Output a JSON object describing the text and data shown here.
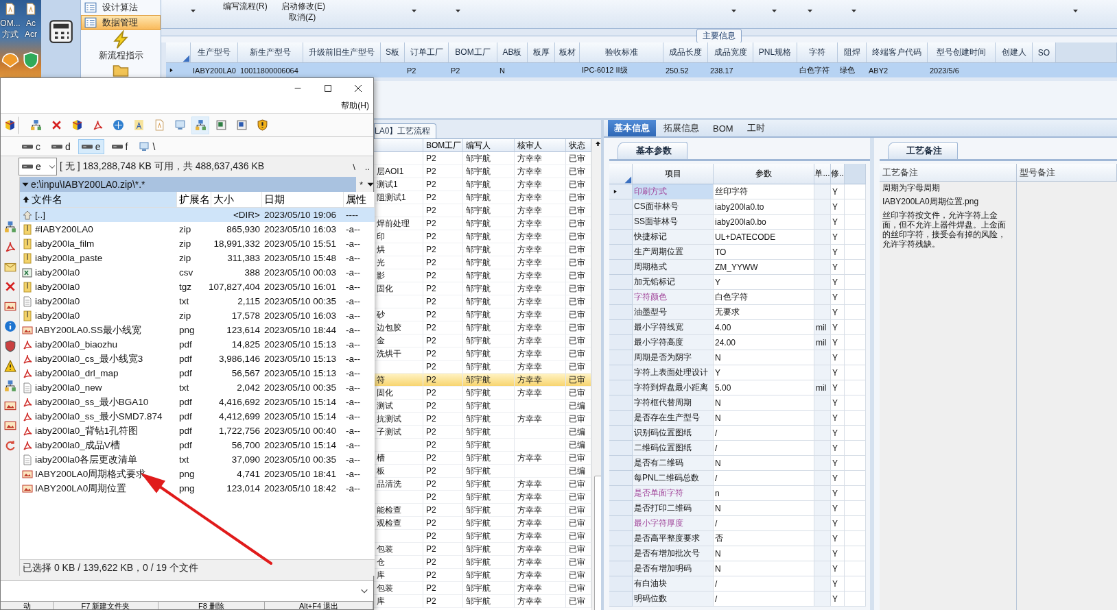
{
  "desktop": {
    "labels": [
      "OM...",
      "方式",
      "Ac",
      "Acr"
    ]
  },
  "nav": {
    "items": [
      {
        "label": "设计算法",
        "kind": "row",
        "selected": false
      },
      {
        "label": "数据管理",
        "kind": "row",
        "selected": true
      },
      {
        "label": "新流程指示",
        "kind": "large",
        "selected": false
      }
    ]
  },
  "ribbon": {
    "commands": [
      "编写流程(R)",
      "启动修改(E)",
      "取消(Z)"
    ]
  },
  "main_info": {
    "title": "主要信息",
    "columns": [
      "生产型号",
      "新生产型号",
      "升级前旧生产型号",
      "S板",
      "订单工厂",
      "BOM工厂",
      "AB板",
      "板厚",
      "板材",
      "验收标准",
      "成品长度",
      "成品宽度",
      "PNL规格",
      "字符",
      "阻焊",
      "终端客户代码",
      "型号创建时间",
      "创建人",
      "SO"
    ],
    "rows": [
      {
        "selected": true,
        "cells": [
          "IABY200LA0",
          "10011800006064",
          null,
          null,
          "P2",
          "P2",
          "N",
          null,
          null,
          "IPC-6012 II级",
          "250.52",
          "238.17",
          null,
          "白色字符",
          "绿色",
          "ABY2",
          "2023/5/6",
          null,
          null
        ]
      }
    ]
  },
  "process_flow": {
    "tab": "LA0】工艺流程",
    "columns": [
      "BOM工厂",
      "编写人",
      "核审人",
      "状态"
    ],
    "rows": [
      {
        "factory": "P2",
        "writer": "邹宇航",
        "reviewer": "方幸幸",
        "status": "已审",
        "selected": false
      },
      {
        "step": "层AOI1",
        "factory": "P2",
        "writer": "邹宇航",
        "reviewer": "方幸幸",
        "status": "已审",
        "selected": false
      },
      {
        "step": "测试1",
        "factory": "P2",
        "writer": "邹宇航",
        "reviewer": "方幸幸",
        "status": "已审",
        "selected": false
      },
      {
        "step": "阻测试1",
        "factory": "P2",
        "writer": "邹宇航",
        "reviewer": "方幸幸",
        "status": "已审",
        "selected": false
      },
      {
        "factory": "P2",
        "writer": "邹宇航",
        "reviewer": "方幸幸",
        "status": "已审",
        "selected": false
      },
      {
        "step": "焊前处理",
        "factory": "P2",
        "writer": "邹宇航",
        "reviewer": "方幸幸",
        "status": "已审",
        "selected": false
      },
      {
        "step": "印",
        "factory": "P2",
        "writer": "邹宇航",
        "reviewer": "方幸幸",
        "status": "已审",
        "selected": false
      },
      {
        "step": "烘",
        "factory": "P2",
        "writer": "邹宇航",
        "reviewer": "方幸幸",
        "status": "已审",
        "selected": false
      },
      {
        "step": "光",
        "factory": "P2",
        "writer": "邹宇航",
        "reviewer": "方幸幸",
        "status": "已审",
        "selected": false
      },
      {
        "step": "影",
        "factory": "P2",
        "writer": "邹宇航",
        "reviewer": "方幸幸",
        "status": "已审",
        "selected": false
      },
      {
        "step": "固化",
        "factory": "P2",
        "writer": "邹宇航",
        "reviewer": "方幸幸",
        "status": "已审",
        "selected": false
      },
      {
        "factory": "P2",
        "writer": "邹宇航",
        "reviewer": "方幸幸",
        "status": "已审",
        "selected": false
      },
      {
        "step": "砂",
        "factory": "P2",
        "writer": "邹宇航",
        "reviewer": "方幸幸",
        "status": "已审",
        "selected": false
      },
      {
        "step": "边包胶",
        "factory": "P2",
        "writer": "邹宇航",
        "reviewer": "方幸幸",
        "status": "已审",
        "selected": false
      },
      {
        "step": "金",
        "factory": "P2",
        "writer": "邹宇航",
        "reviewer": "方幸幸",
        "status": "已审",
        "selected": false
      },
      {
        "step": "洗烘干",
        "factory": "P2",
        "writer": "邹宇航",
        "reviewer": "方幸幸",
        "status": "已审",
        "selected": false
      },
      {
        "factory": "P2",
        "writer": "邹宇航",
        "reviewer": "方幸幸",
        "status": "已审",
        "selected": false
      },
      {
        "step": "符",
        "factory": "P2",
        "writer": "邹宇航",
        "reviewer": "方幸幸",
        "status": "已审",
        "selected": true
      },
      {
        "step": "固化",
        "factory": "P2",
        "writer": "邹宇航",
        "reviewer": "方幸幸",
        "status": "已审",
        "selected": false
      },
      {
        "step": "测试",
        "factory": "P2",
        "writer": "邹宇航",
        "status": "已编",
        "selected": false
      },
      {
        "step": "抗测试",
        "factory": "P2",
        "writer": "邹宇航",
        "reviewer": "方幸幸",
        "status": "已审",
        "selected": false
      },
      {
        "step": "子测试",
        "factory": "P2",
        "writer": "邹宇航",
        "status": "已编",
        "selected": false
      },
      {
        "factory": "P2",
        "writer": "邹宇航",
        "status": "已编",
        "selected": false
      },
      {
        "step": "槽",
        "factory": "P2",
        "writer": "邹宇航",
        "reviewer": "方幸幸",
        "status": "已审",
        "selected": false
      },
      {
        "step": "板",
        "factory": "P2",
        "writer": "邹宇航",
        "status": "已编",
        "selected": false
      },
      {
        "step": "品清洗",
        "factory": "P2",
        "writer": "邹宇航",
        "reviewer": "方幸幸",
        "status": "已审",
        "selected": false
      },
      {
        "factory": "P2",
        "writer": "邹宇航",
        "reviewer": "方幸幸",
        "status": "已审",
        "selected": false
      },
      {
        "step": "能检查",
        "factory": "P2",
        "writer": "邹宇航",
        "reviewer": "方幸幸",
        "status": "已审",
        "selected": false
      },
      {
        "step": "观检查",
        "factory": "P2",
        "writer": "邹宇航",
        "reviewer": "方幸幸",
        "status": "已审",
        "selected": false
      },
      {
        "factory": "P2",
        "writer": "邹宇航",
        "reviewer": "方幸幸",
        "status": "已审",
        "selected": false
      },
      {
        "step": "包装",
        "factory": "P2",
        "writer": "邹宇航",
        "reviewer": "方幸幸",
        "status": "已审",
        "selected": false
      },
      {
        "step": "仓",
        "factory": "P2",
        "writer": "邹宇航",
        "reviewer": "方幸幸",
        "status": "已审",
        "selected": false
      },
      {
        "step": "库",
        "factory": "P2",
        "writer": "邹宇航",
        "reviewer": "方幸幸",
        "status": "已审",
        "selected": false
      },
      {
        "step": "包装",
        "factory": "P2",
        "writer": "邹宇航",
        "reviewer": "方幸幸",
        "status": "已审",
        "selected": false
      },
      {
        "step": "库",
        "factory": "P2",
        "writer": "邹宇航",
        "reviewer": "方幸幸",
        "status": "已审",
        "selected": false
      }
    ]
  },
  "right_panel": {
    "tabs": [
      {
        "label": "基本信息",
        "selected": true
      },
      {
        "label": "拓展信息",
        "selected": false
      },
      {
        "label": "BOM",
        "selected": false
      },
      {
        "label": "工时",
        "selected": false
      }
    ],
    "params": {
      "tab": "基本参数",
      "columns": [
        "项目",
        "参数",
        "单...",
        "修.."
      ],
      "rows": [
        {
          "item": "印刷方式",
          "value": "丝印字符",
          "flag": "Y",
          "flagged": true,
          "selected": true
        },
        {
          "item": "CS面菲林号",
          "value": "iaby200la0.to",
          "flag": "Y",
          "flagged": false,
          "selected": false
        },
        {
          "item": "SS面菲林号",
          "value": "iaby200la0.bo",
          "flag": "Y",
          "flagged": false,
          "selected": false
        },
        {
          "item": "快捷标记",
          "value": "UL+DATECODE",
          "flag": "Y",
          "flagged": false,
          "selected": false
        },
        {
          "item": "生产周期位置",
          "value": "TO",
          "flag": "Y",
          "flagged": false,
          "selected": false
        },
        {
          "item": "周期格式",
          "value": "ZM_YYWW",
          "flag": "Y",
          "flagged": false,
          "selected": false
        },
        {
          "item": "加无铅标记",
          "value": "Y",
          "flag": "Y",
          "flagged": false,
          "selected": false
        },
        {
          "item": "字符颜色",
          "value": "白色字符",
          "flag": "Y",
          "flagged": true,
          "selected": false
        },
        {
          "item": "油墨型号",
          "value": "无要求",
          "flag": "Y",
          "flagged": false,
          "selected": false
        },
        {
          "item": "最小字符线宽",
          "value": "4.00",
          "unit": "mil",
          "flag": "Y",
          "flagged": false,
          "selected": false
        },
        {
          "item": "最小字符高度",
          "value": "24.00",
          "unit": "mil",
          "flag": "Y",
          "flagged": false,
          "selected": false
        },
        {
          "item": "周期是否为阴字",
          "value": "N",
          "flag": "Y",
          "flagged": false,
          "selected": false
        },
        {
          "item": "字符上表面处理设计",
          "value": "Y",
          "flag": "Y",
          "flagged": false,
          "selected": false
        },
        {
          "item": "字符到焊盘最小距离",
          "value": "5.00",
          "unit": "mil",
          "flag": "Y",
          "flagged": false,
          "selected": false
        },
        {
          "item": "字符框代替周期",
          "value": "N",
          "flag": "Y",
          "flagged": false,
          "selected": false
        },
        {
          "item": "是否存在生产型号",
          "value": "N",
          "flag": "Y",
          "flagged": false,
          "selected": false
        },
        {
          "item": "识别码位置图纸",
          "value": "/",
          "flag": "Y",
          "flagged": false,
          "selected": false
        },
        {
          "item": "二维码位置图纸",
          "value": "/",
          "flag": "Y",
          "flagged": false,
          "selected": false
        },
        {
          "item": "是否有二维码",
          "value": "N",
          "flag": "Y",
          "flagged": false,
          "selected": false
        },
        {
          "item": "每PNL二维码总数",
          "value": "/",
          "flag": "Y",
          "flagged": false,
          "selected": false
        },
        {
          "item": "是否单面字符",
          "value": "n",
          "flag": "Y",
          "flagged": true,
          "selected": false
        },
        {
          "item": "是否打印二维码",
          "value": "N",
          "flag": "Y",
          "flagged": false,
          "selected": false
        },
        {
          "item": "最小字符厚度",
          "value": "/",
          "flag": "Y",
          "flagged": true,
          "selected": false
        },
        {
          "item": "是否高平整度要求",
          "value": "否",
          "flag": "Y",
          "flagged": false,
          "selected": false
        },
        {
          "item": "是否有增加批次号",
          "value": "N",
          "flag": "Y",
          "flagged": false,
          "selected": false
        },
        {
          "item": "是否有增加明码",
          "value": "N",
          "flag": "Y",
          "flagged": false,
          "selected": false
        },
        {
          "item": "有白油块",
          "value": "/",
          "flag": "Y",
          "flagged": false,
          "selected": false
        },
        {
          "item": "明码位数",
          "value": "/",
          "flag": "Y",
          "flagged": false,
          "selected": false
        }
      ]
    },
    "notes": {
      "tab": "工艺备注",
      "columns": [
        "工艺备注",
        "型号备注"
      ],
      "lines": [
        "周期为字母周期",
        "IABY200LA0周期位置.png",
        "丝印字符按文件，允许字符上金面，但不允许上器件焊盘。上金面的丝印字符，接受会有掉的风险，允许字符残缺。"
      ]
    }
  },
  "file_manager": {
    "menu": [
      "帮助(H)"
    ],
    "drives": [
      {
        "label": "c",
        "selected": false
      },
      {
        "label": "d",
        "selected": false
      },
      {
        "label": "e",
        "selected": true
      },
      {
        "label": "f",
        "selected": false
      },
      {
        "label": "\\",
        "selected": false
      }
    ],
    "drive_combo": "e",
    "free_space": "[ 无 ]  183,288,748 KB 可用，共 488,637,436 KB",
    "nav_buttons": [
      "\\",
      ".."
    ],
    "path": "e:\\inpu\\IABY200LA0.zip\\*.*",
    "filter_buttons": [
      "*"
    ],
    "columns": [
      "文件名",
      "扩展名",
      "大小",
      "日期",
      "属性"
    ],
    "files": [
      {
        "kind": "parent",
        "name": "[..]",
        "size": "<DIR>",
        "date": "2023/05/10 19:06",
        "attr": "----",
        "selected": true
      },
      {
        "kind": "archive",
        "name": "#IABY200LA0",
        "ext": "zip",
        "size": "865,930",
        "date": "2023/05/10 16:03",
        "attr": "-a--",
        "selected": false
      },
      {
        "kind": "archive",
        "name": "iaby200la_film",
        "ext": "zip",
        "size": "18,991,332",
        "date": "2023/05/10 15:51",
        "attr": "-a--",
        "selected": false
      },
      {
        "kind": "archive",
        "name": "iaby200la_paste",
        "ext": "zip",
        "size": "311,383",
        "date": "2023/05/10 15:48",
        "attr": "-a--",
        "selected": false
      },
      {
        "kind": "spreadsheet",
        "name": "iaby200la0",
        "ext": "csv",
        "size": "388",
        "date": "2023/05/10 00:03",
        "attr": "-a--",
        "selected": false
      },
      {
        "kind": "archive",
        "name": "iaby200la0",
        "ext": "tgz",
        "size": "107,827,404",
        "date": "2023/05/10 16:01",
        "attr": "-a--",
        "selected": false
      },
      {
        "kind": "text",
        "name": "iaby200la0",
        "ext": "txt",
        "size": "2,115",
        "date": "2023/05/10 00:35",
        "attr": "-a--",
        "selected": false
      },
      {
        "kind": "archive",
        "name": "iaby200la0",
        "ext": "zip",
        "size": "17,578",
        "date": "2023/05/10 16:03",
        "attr": "-a--",
        "selected": false
      },
      {
        "kind": "image",
        "name": "IABY200LA0.SS最小线宽",
        "ext": "png",
        "size": "123,614",
        "date": "2023/05/10 18:44",
        "attr": "-a--",
        "selected": false
      },
      {
        "kind": "pdf",
        "name": "iaby200la0_biaozhu",
        "ext": "pdf",
        "size": "14,825",
        "date": "2023/05/10 15:13",
        "attr": "-a--",
        "selected": false
      },
      {
        "kind": "pdf",
        "name": "iaby200la0_cs_最小线宽3",
        "ext": "pdf",
        "size": "3,986,146",
        "date": "2023/05/10 15:13",
        "attr": "-a--",
        "selected": false
      },
      {
        "kind": "pdf",
        "name": "iaby200la0_drl_map",
        "ext": "pdf",
        "size": "56,567",
        "date": "2023/05/10 15:13",
        "attr": "-a--",
        "selected": false
      },
      {
        "kind": "text",
        "name": "iaby200la0_new",
        "ext": "txt",
        "size": "2,042",
        "date": "2023/05/10 00:35",
        "attr": "-a--",
        "selected": false
      },
      {
        "kind": "pdf",
        "name": "iaby200la0_ss_最小BGA10",
        "ext": "pdf",
        "size": "4,416,692",
        "date": "2023/05/10 15:14",
        "attr": "-a--",
        "selected": false
      },
      {
        "kind": "pdf",
        "name": "iaby200la0_ss_最小SMD7.874",
        "ext": "pdf",
        "size": "4,412,699",
        "date": "2023/05/10 15:14",
        "attr": "-a--",
        "selected": false
      },
      {
        "kind": "pdf",
        "name": "iaby200la0_背钻1孔符图",
        "ext": "pdf",
        "size": "1,722,756",
        "date": "2023/05/10 00:40",
        "attr": "-a--",
        "selected": false
      },
      {
        "kind": "pdf",
        "name": "iaby200la0_成品V槽",
        "ext": "pdf",
        "size": "56,700",
        "date": "2023/05/10 15:14",
        "attr": "-a--",
        "selected": false
      },
      {
        "kind": "text",
        "name": "iaby200la0各层更改清单",
        "ext": "txt",
        "size": "37,090",
        "date": "2023/05/10 00:35",
        "attr": "-a--",
        "selected": false
      },
      {
        "kind": "image",
        "name": "IABY200LA0周期格式要求",
        "ext": "png",
        "size": "4,741",
        "date": "2023/05/10 18:41",
        "attr": "-a--",
        "selected": false
      },
      {
        "kind": "image",
        "name": "IABY200LA0周期位置",
        "ext": "png",
        "size": "123,014",
        "date": "2023/05/10 18:42",
        "attr": "-a--",
        "selected": false
      }
    ],
    "status": "已选择 0 KB / 139,622 KB，0 / 19 个文件",
    "function_keys": [
      "动",
      "F7 新建文件夹",
      "F8 删除",
      "Alt+F4 退出"
    ]
  }
}
